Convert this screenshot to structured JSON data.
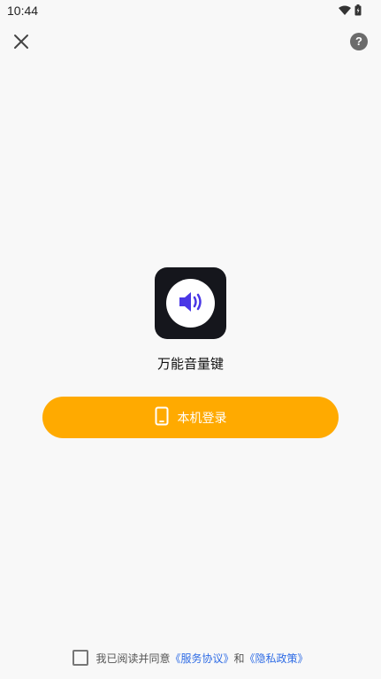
{
  "status_bar": {
    "time": "10:44",
    "icons": [
      "wifi-icon",
      "battery-icon"
    ]
  },
  "top_bar": {
    "close_icon": "close-icon",
    "help_label": "?"
  },
  "app": {
    "name": "万能音量键",
    "logo_icon": "speaker-icon",
    "logo_colors": {
      "background": "#15161c",
      "circle": "#ffffff",
      "speaker": "#4a37e6"
    }
  },
  "login": {
    "label": "本机登录",
    "icon": "phone-icon",
    "color": "#ffaa00"
  },
  "agreement": {
    "checked": false,
    "prefix": "我已阅读并同意",
    "service_link": "《服务协议》",
    "and_text": "和",
    "privacy_link": "《隐私政策》",
    "link_color": "#2f6ce5"
  }
}
